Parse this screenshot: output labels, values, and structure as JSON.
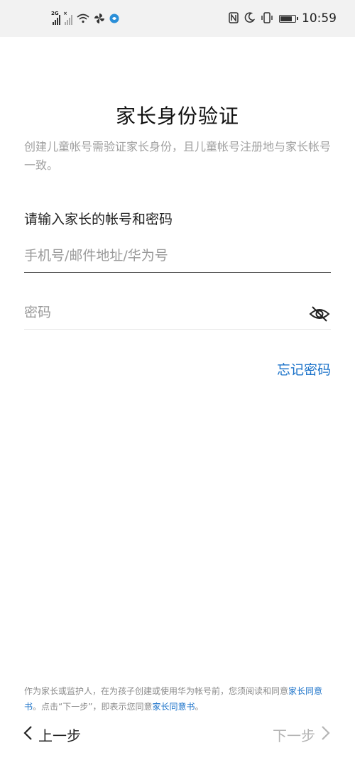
{
  "status_bar": {
    "network_1": "2G",
    "network_2": "×",
    "time": "10:59"
  },
  "page": {
    "title": "家长身份验证",
    "subtitle": "创建儿童帐号需验证家长身份，且儿童帐号注册地与家长帐号一致。",
    "section_label": "请输入家长的帐号和密码"
  },
  "form": {
    "account": {
      "value": "",
      "placeholder": "手机号/邮件地址/华为号"
    },
    "password": {
      "value": "",
      "placeholder": "密码"
    },
    "forgot_label": "忘记密码"
  },
  "consent": {
    "text_1": "作为家长或监护人，在为孩子创建或使用华为帐号前，您须阅读和同意",
    "link_1": "家长同意书",
    "text_2": "。点击“下一步”，即表示您同意",
    "link_2": "家长同意书",
    "text_3": "。"
  },
  "navigation": {
    "back_label": "上一步",
    "next_label": "下一步"
  },
  "colors": {
    "accent": "#1a72c9",
    "status_bar_bg": "#f2f2f2",
    "muted_text": "#a0a0a0",
    "disabled_text": "#b5b5b5"
  }
}
